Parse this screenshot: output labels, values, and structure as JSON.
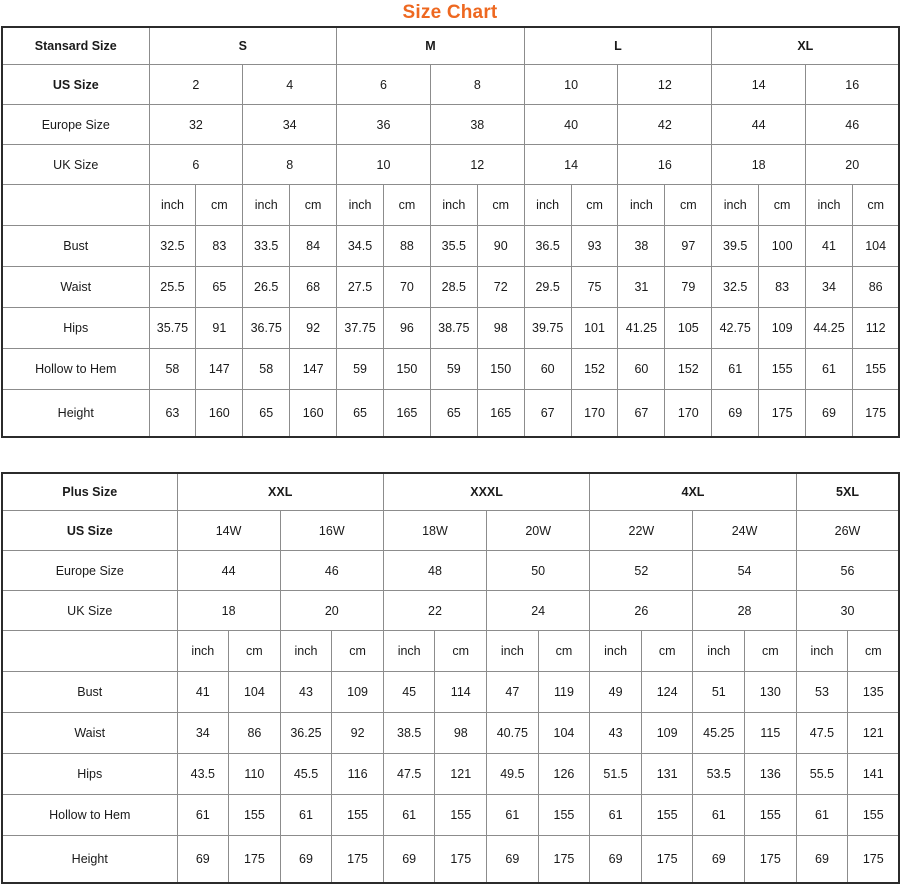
{
  "title": "Size Chart",
  "accent_color": "#ee6820",
  "border_color": "#2b2b2b",
  "grid_color": "#8c8c8c",
  "table1": {
    "corner_label": "Stansard Size",
    "groups": [
      "S",
      "M",
      "L",
      "XL"
    ],
    "rows": [
      {
        "label": "US Size",
        "bold": true,
        "values": [
          "2",
          "4",
          "6",
          "8",
          "10",
          "12",
          "14",
          "16"
        ]
      },
      {
        "label": "Europe Size",
        "bold": false,
        "values": [
          "32",
          "34",
          "36",
          "38",
          "40",
          "42",
          "44",
          "46"
        ]
      },
      {
        "label": "UK Size",
        "bold": false,
        "values": [
          "6",
          "8",
          "10",
          "12",
          "14",
          "16",
          "18",
          "20"
        ]
      }
    ],
    "unit_row": {
      "label": "",
      "units": [
        "inch",
        "cm",
        "inch",
        "cm",
        "inch",
        "cm",
        "inch",
        "cm",
        "inch",
        "cm",
        "inch",
        "cm",
        "inch",
        "cm",
        "inch",
        "cm"
      ]
    },
    "measurements": [
      {
        "label": "Bust",
        "values": [
          "32.5",
          "83",
          "33.5",
          "84",
          "34.5",
          "88",
          "35.5",
          "90",
          "36.5",
          "93",
          "38",
          "97",
          "39.5",
          "100",
          "41",
          "104"
        ]
      },
      {
        "label": "Waist",
        "values": [
          "25.5",
          "65",
          "26.5",
          "68",
          "27.5",
          "70",
          "28.5",
          "72",
          "29.5",
          "75",
          "31",
          "79",
          "32.5",
          "83",
          "34",
          "86"
        ]
      },
      {
        "label": "Hips",
        "values": [
          "35.75",
          "91",
          "36.75",
          "92",
          "37.75",
          "96",
          "38.75",
          "98",
          "39.75",
          "101",
          "41.25",
          "105",
          "42.75",
          "109",
          "44.25",
          "112"
        ]
      },
      {
        "label": "Hollow to Hem",
        "values": [
          "58",
          "147",
          "58",
          "147",
          "59",
          "150",
          "59",
          "150",
          "60",
          "152",
          "60",
          "152",
          "61",
          "155",
          "61",
          "155"
        ]
      },
      {
        "label": "Height",
        "values": [
          "63",
          "160",
          "65",
          "160",
          "65",
          "165",
          "65",
          "165",
          "67",
          "170",
          "67",
          "170",
          "69",
          "175",
          "69",
          "175"
        ]
      }
    ]
  },
  "table2": {
    "corner_label": "Plus Size",
    "groups": [
      "XXL",
      "XXXL",
      "4XL",
      "5XL"
    ],
    "group_spans": [
      2,
      2,
      2,
      1
    ],
    "rows": [
      {
        "label": "US Size",
        "bold": true,
        "values": [
          "14W",
          "16W",
          "18W",
          "20W",
          "22W",
          "24W",
          "26W"
        ]
      },
      {
        "label": "Europe Size",
        "bold": false,
        "values": [
          "44",
          "46",
          "48",
          "50",
          "52",
          "54",
          "56"
        ]
      },
      {
        "label": "UK Size",
        "bold": false,
        "values": [
          "18",
          "20",
          "22",
          "24",
          "26",
          "28",
          "30"
        ]
      }
    ],
    "unit_row": {
      "label": "",
      "units": [
        "inch",
        "cm",
        "inch",
        "cm",
        "inch",
        "cm",
        "inch",
        "cm",
        "inch",
        "cm",
        "inch",
        "cm",
        "inch",
        "cm"
      ]
    },
    "measurements": [
      {
        "label": "Bust",
        "values": [
          "41",
          "104",
          "43",
          "109",
          "45",
          "114",
          "47",
          "119",
          "49",
          "124",
          "51",
          "130",
          "53",
          "135"
        ]
      },
      {
        "label": "Waist",
        "values": [
          "34",
          "86",
          "36.25",
          "92",
          "38.5",
          "98",
          "40.75",
          "104",
          "43",
          "109",
          "45.25",
          "115",
          "47.5",
          "121"
        ]
      },
      {
        "label": "Hips",
        "values": [
          "43.5",
          "110",
          "45.5",
          "116",
          "47.5",
          "121",
          "49.5",
          "126",
          "51.5",
          "131",
          "53.5",
          "136",
          "55.5",
          "141"
        ]
      },
      {
        "label": "Hollow to Hem",
        "values": [
          "61",
          "155",
          "61",
          "155",
          "61",
          "155",
          "61",
          "155",
          "61",
          "155",
          "61",
          "155",
          "61",
          "155"
        ]
      },
      {
        "label": "Height",
        "values": [
          "69",
          "175",
          "69",
          "175",
          "69",
          "175",
          "69",
          "175",
          "69",
          "175",
          "69",
          "175",
          "69",
          "175"
        ]
      }
    ]
  }
}
